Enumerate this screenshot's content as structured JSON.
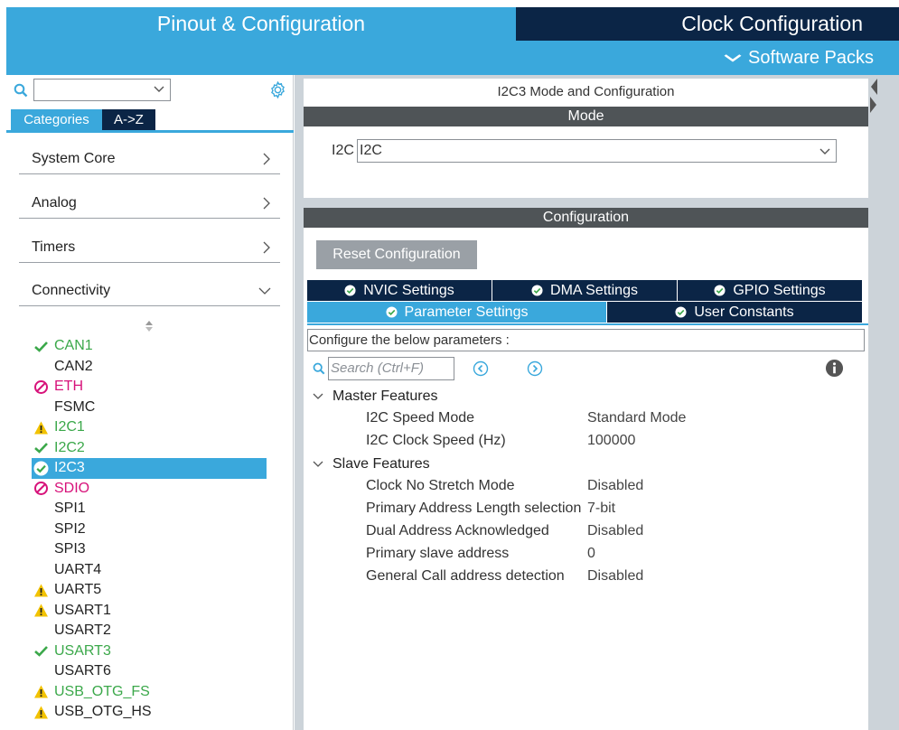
{
  "top_tabs": {
    "pinout": "Pinout & Configuration",
    "clock": "Clock Configuration"
  },
  "software_packs": "Software Packs",
  "left_panel": {
    "search_value": "",
    "tabs": {
      "categories": "Categories",
      "atoz": "A->Z"
    },
    "categories": [
      "System Core",
      "Analog",
      "Timers",
      "Connectivity"
    ],
    "peripherals": [
      {
        "name": "CAN1",
        "status": "ok"
      },
      {
        "name": "CAN2",
        "status": "none"
      },
      {
        "name": "ETH",
        "status": "disabled"
      },
      {
        "name": "FSMC",
        "status": "none"
      },
      {
        "name": "I2C1",
        "status": "warning"
      },
      {
        "name": "I2C2",
        "status": "ok"
      },
      {
        "name": "I2C3",
        "status": "selected"
      },
      {
        "name": "SDIO",
        "status": "disabled"
      },
      {
        "name": "SPI1",
        "status": "none"
      },
      {
        "name": "SPI2",
        "status": "none"
      },
      {
        "name": "SPI3",
        "status": "none"
      },
      {
        "name": "UART4",
        "status": "none"
      },
      {
        "name": "UART5",
        "status": "warning-plain"
      },
      {
        "name": "USART1",
        "status": "warning-plain"
      },
      {
        "name": "USART2",
        "status": "none"
      },
      {
        "name": "USART3",
        "status": "ok"
      },
      {
        "name": "USART6",
        "status": "none"
      },
      {
        "name": "USB_OTG_FS",
        "status": "warning"
      },
      {
        "name": "USB_OTG_HS",
        "status": "warning-plain"
      }
    ]
  },
  "mode_panel": {
    "title": "I2C3 Mode and Configuration",
    "mode_header": "Mode",
    "i2c_label": "I2C",
    "i2c_value": "I2C"
  },
  "config_panel": {
    "header": "Configuration",
    "reset_button": "Reset Configuration",
    "tabs_row1": [
      "NVIC Settings",
      "DMA Settings",
      "GPIO Settings"
    ],
    "tabs_row2": [
      "Parameter Settings",
      "User Constants"
    ],
    "description": "Configure the below parameters :",
    "search_placeholder": "Search (Ctrl+F)",
    "groups": [
      {
        "name": "Master Features",
        "params": [
          {
            "name": "I2C Speed Mode",
            "value": "Standard Mode"
          },
          {
            "name": "I2C Clock Speed (Hz)",
            "value": "100000"
          }
        ]
      },
      {
        "name": "Slave Features",
        "params": [
          {
            "name": "Clock No Stretch Mode",
            "value": "Disabled"
          },
          {
            "name": "Primary Address Length selection",
            "value": "7-bit"
          },
          {
            "name": "Dual Address Acknowledged",
            "value": "Disabled"
          },
          {
            "name": "Primary slave address",
            "value": "0"
          },
          {
            "name": "General Call address detection",
            "value": "Disabled"
          }
        ]
      }
    ]
  },
  "colors": {
    "accent": "#3aa8dc",
    "navy": "#0b2546",
    "ok_green": "#3ba84a",
    "disabled_magenta": "#d7127a",
    "warning_yellow": "#f2c200",
    "header_gray": "#4f5457"
  }
}
